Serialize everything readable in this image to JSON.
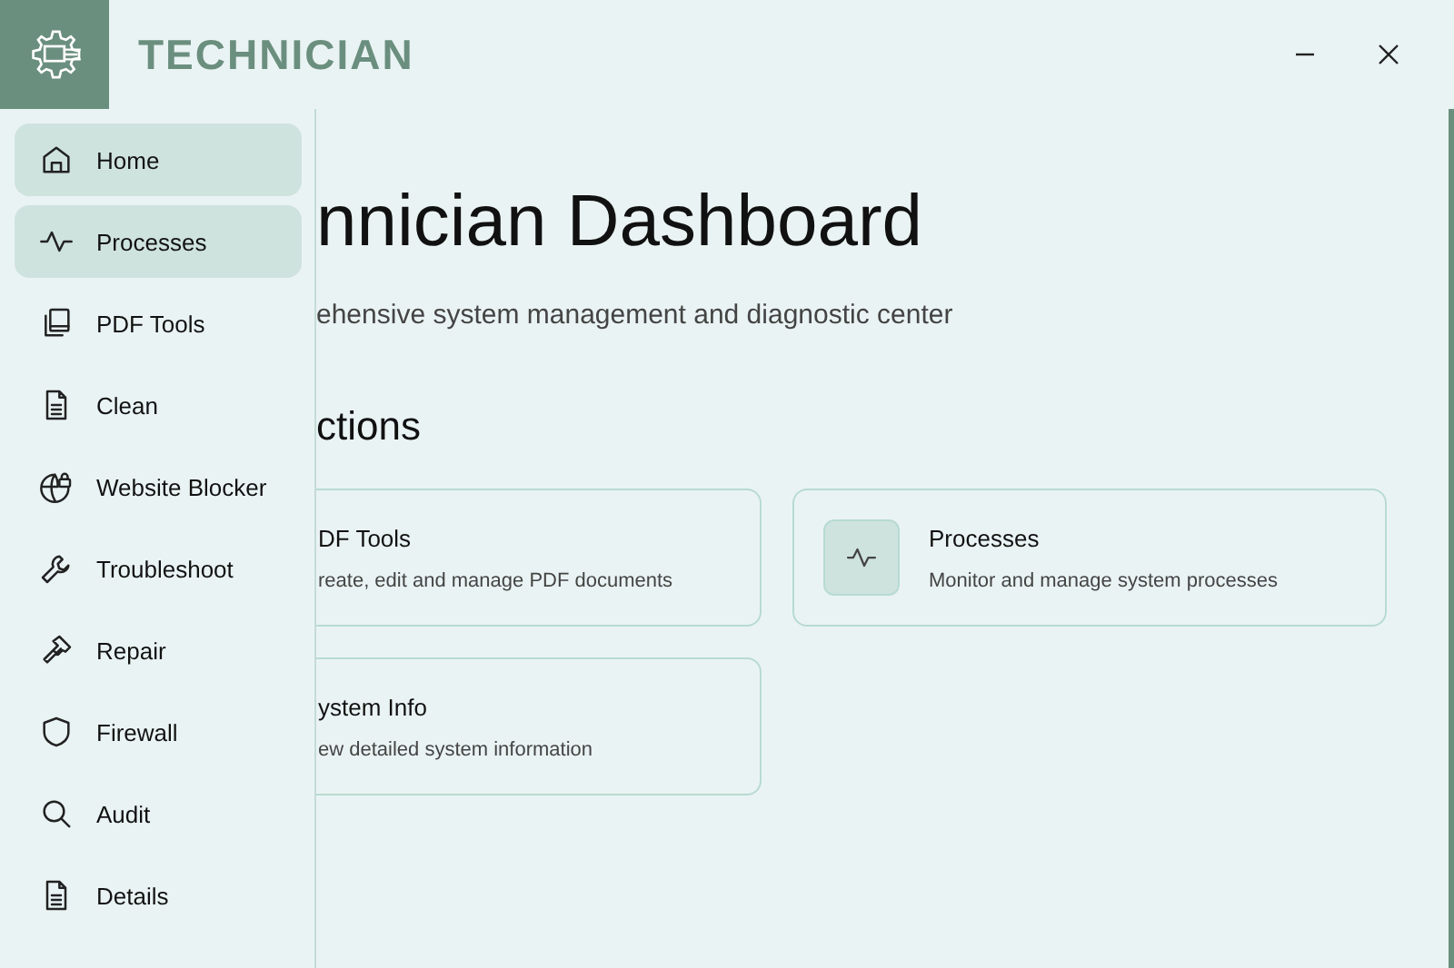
{
  "app": {
    "title": "TECHNICIAN"
  },
  "window_controls": [
    {
      "kind": "minimize"
    },
    {
      "kind": "close"
    }
  ],
  "sidebar": {
    "items": [
      {
        "label": "Home",
        "kind": "home",
        "selected": true
      },
      {
        "label": "Processes",
        "kind": "pulse",
        "selected": true
      },
      {
        "label": "PDF Tools",
        "kind": "copy",
        "selected": false
      },
      {
        "label": "Clean",
        "kind": "doc",
        "selected": false
      },
      {
        "label": "Website Blocker",
        "kind": "globe",
        "selected": false
      },
      {
        "label": "Troubleshoot",
        "kind": "wrench",
        "selected": false
      },
      {
        "label": "Repair",
        "kind": "hammer",
        "selected": false
      },
      {
        "label": "Firewall",
        "kind": "shield",
        "selected": false
      },
      {
        "label": "Audit",
        "kind": "search",
        "selected": false
      },
      {
        "label": "Details",
        "kind": "doc",
        "selected": false
      }
    ]
  },
  "main": {
    "title": "nnician Dashboard",
    "subtitle": "ehensive system management and diagnostic center",
    "section_title": "ctions",
    "cards": [
      {
        "title": "DF Tools",
        "description": "reate, edit and manage PDF documents",
        "kind": "plain"
      },
      {
        "title": "Processes",
        "description": "Monitor and manage system processes",
        "kind": "pulse"
      },
      {
        "title": "ystem Info",
        "description": "ew detailed system information",
        "kind": "plain"
      }
    ]
  }
}
